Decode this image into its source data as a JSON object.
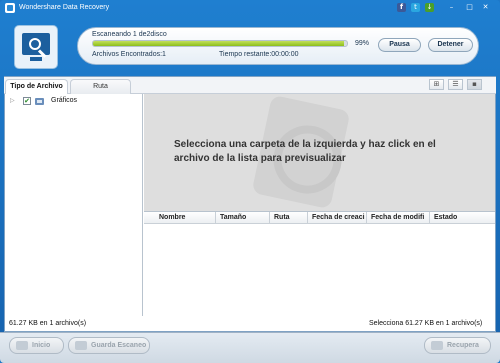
{
  "app": {
    "title": "Wondershare Data Recovery"
  },
  "titlebar": {
    "facebook_icon": "facebook-icon",
    "twitter_icon": "twitter-icon",
    "download_icon": "download-icon",
    "minimize_glyph": "–",
    "maximize_glyph": "□",
    "close_glyph": "✕"
  },
  "scan": {
    "status": "Escaneando 1 de2disco",
    "progress_percent": 99,
    "progress_label": "99%",
    "files_found": "Archivos Encontrados:1",
    "time_remaining": "Tiempo restante:00:00:00",
    "pause_label": "Pausa",
    "stop_label": "Detener"
  },
  "tabs": [
    {
      "label": "Tipo de Archivo",
      "active": true
    },
    {
      "label": "Ruta",
      "active": false
    }
  ],
  "view_modes": [
    "thumbnail-view",
    "list-view",
    "detail-view"
  ],
  "tree": {
    "items": [
      {
        "label": "Gráficos",
        "checked": true,
        "check_glyph": "✔",
        "expand_glyph": "▷"
      }
    ]
  },
  "preview": {
    "message": "Selecciona una carpeta de la izquierda y haz click en el archivo de la lista para previsualizar"
  },
  "table": {
    "columns": [
      "Nombre",
      "Tamaño",
      "Ruta",
      "Fecha de creaci",
      "Fecha de modifi",
      "Estado"
    ],
    "rows": []
  },
  "status": {
    "left": "61.27 KB en 1 archivo(s)",
    "right": "Selecciona 61.27 KB en 1 archivo(s)"
  },
  "footer": {
    "start_label": "Inicio",
    "save_scan_label": "Guarda Escaneo",
    "recover_label": "Recupera"
  },
  "colors": {
    "window_blue": "#1f7fd0",
    "progress_green": "#8cbf1c",
    "preview_gray": "#dedede"
  }
}
